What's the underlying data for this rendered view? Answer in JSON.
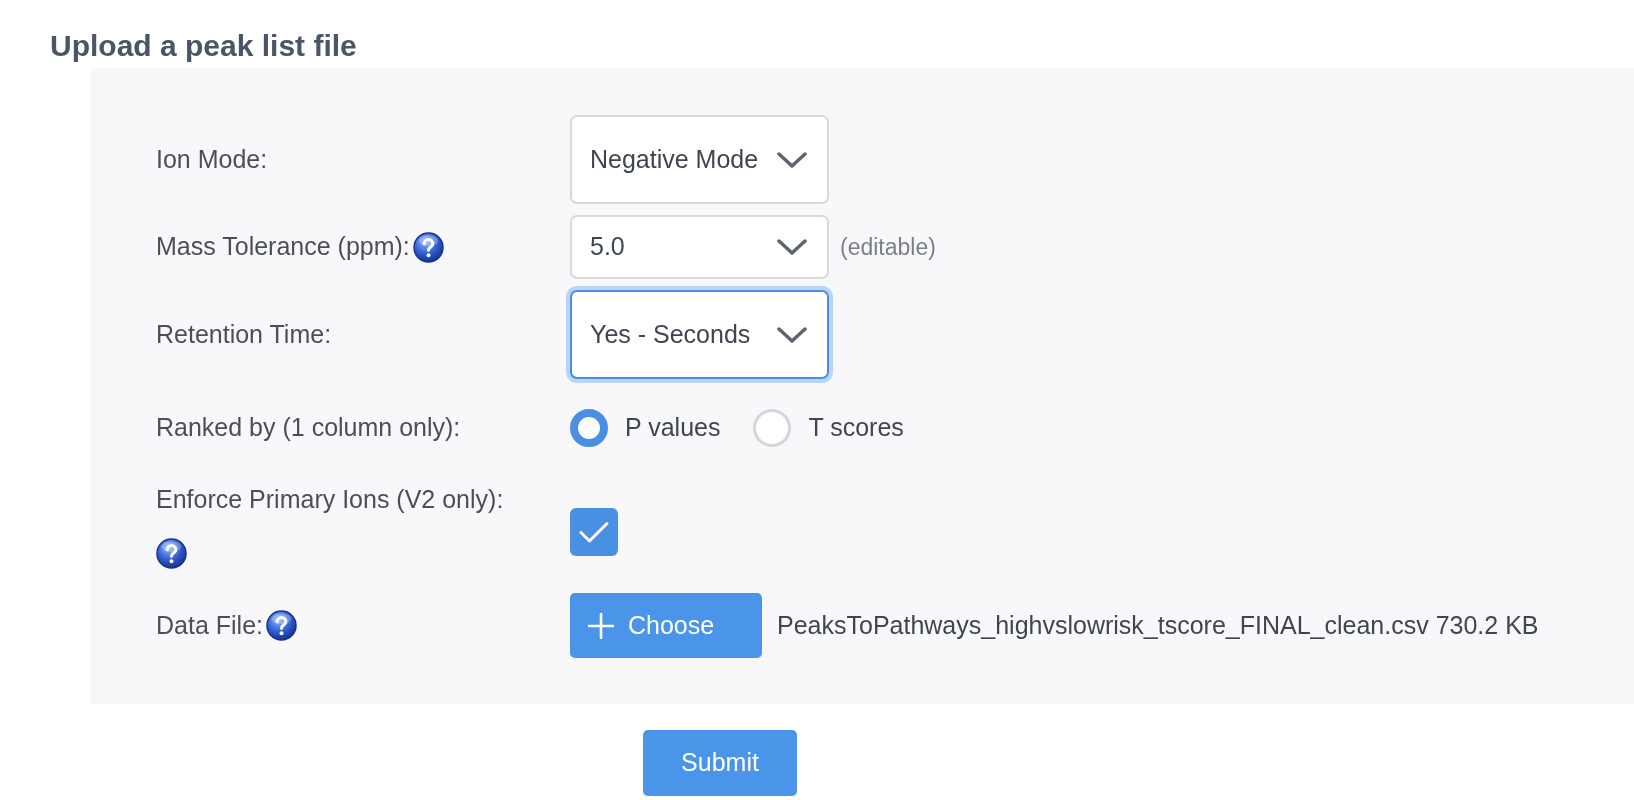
{
  "heading": "Upload a peak list file",
  "fields": [
    {
      "kind": "select",
      "label": "Ion Mode:",
      "help": false,
      "value": "Negative Mode",
      "focused": false
    },
    {
      "kind": "editable_select",
      "label": "Mass Tolerance (ppm):",
      "help": true,
      "value": "5.0",
      "focused": false,
      "note": "(editable)"
    },
    {
      "kind": "select",
      "label": "Retention Time:",
      "help": false,
      "value": "Yes - Seconds",
      "focused": true
    },
    {
      "kind": "radio",
      "label": "Ranked by (1 column only):",
      "help": false,
      "options": [
        {
          "label": "P values",
          "selected": true
        },
        {
          "label": "T scores",
          "selected": false
        }
      ]
    },
    {
      "kind": "checkbox",
      "label": "Enforce Primary Ions (V2 only):",
      "help": true,
      "checked": true
    },
    {
      "kind": "file",
      "label": "Data File:",
      "help": true,
      "button": "Choose",
      "file_name": "PeaksToPathways_highvslowrisk_tscore_FINAL_clean.csv 730.2 KB"
    }
  ],
  "submit": "Submit"
}
